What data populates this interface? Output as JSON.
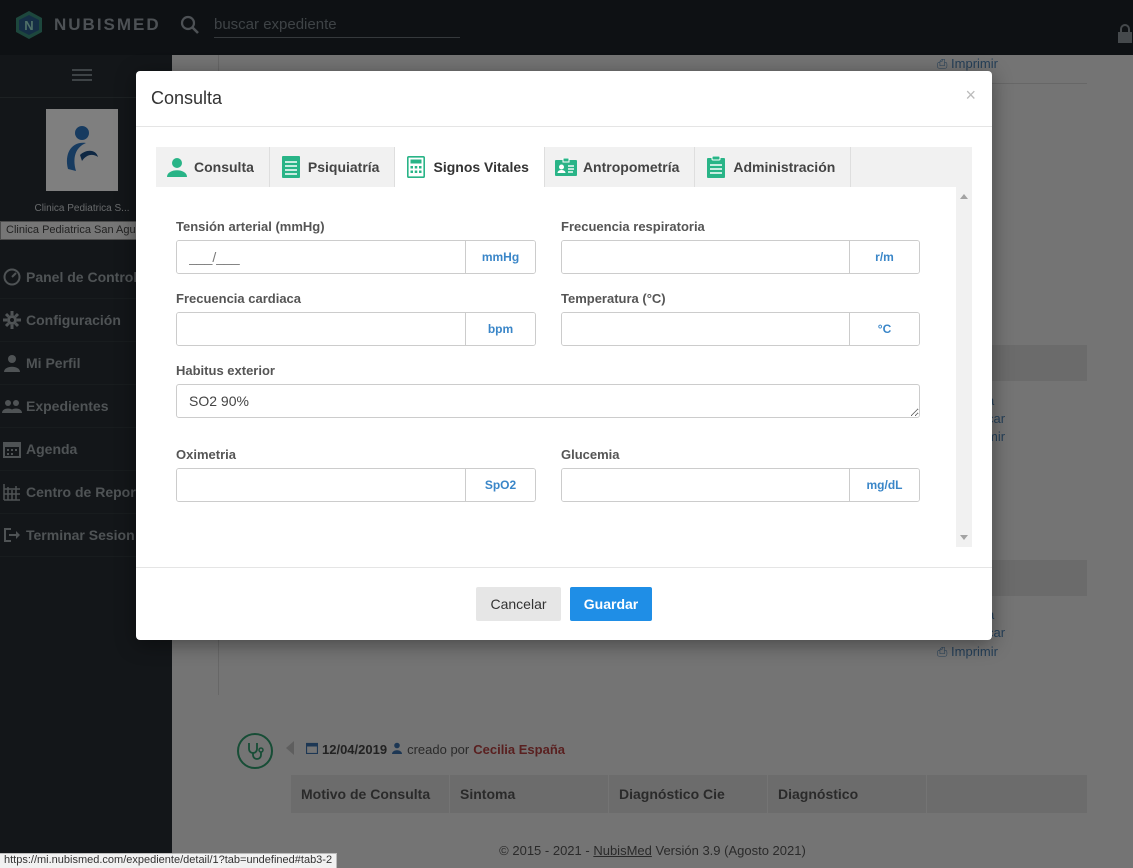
{
  "app": {
    "brand": "NUBISMED"
  },
  "search": {
    "placeholder": "buscar expediente"
  },
  "sidebar": {
    "clinic_name_short": "Clinica Pediatrica S...",
    "clinic_select_value": "Clinica Pediatrica San Agustin",
    "items": [
      {
        "label": "Panel de Control",
        "icon": "dashboard-icon"
      },
      {
        "label": "Configuración",
        "icon": "gear-icon"
      },
      {
        "label": "Mi Perfil",
        "icon": "user-icon"
      },
      {
        "label": "Expedientes",
        "icon": "users-icon"
      },
      {
        "label": "Agenda",
        "icon": "calendar-icon"
      },
      {
        "label": "Centro de Reportes",
        "icon": "report-icon"
      },
      {
        "label": "Terminar Sesion",
        "icon": "logout-icon"
      }
    ]
  },
  "background": {
    "print_link": "Imprimir",
    "partial_links": [
      "a",
      "car",
      "mir"
    ],
    "entry": {
      "date": "12/04/2019",
      "created_by_text": "creado por",
      "author": "Cecilia España"
    },
    "table_headers": [
      "Motivo de Consulta",
      "Sintoma",
      "Diagnóstico Cie",
      "Diagnóstico"
    ],
    "footer": {
      "prefix": "© 2015 - 2021 -",
      "brand": "NubisMed",
      "suffix": "Versión 3.9 (Agosto 2021)"
    },
    "status_url": "https://mi.nubismed.com/expediente/detail/1?tab=undefined#tab3-2"
  },
  "modal": {
    "title": "Consulta",
    "close": "×",
    "tabs": [
      {
        "label": "Consulta",
        "icon": "user-icon"
      },
      {
        "label": "Psiquiatría",
        "icon": "document-icon"
      },
      {
        "label": "Signos Vitales",
        "icon": "calculator-icon",
        "active": true
      },
      {
        "label": "Antropometría",
        "icon": "id-card-icon"
      },
      {
        "label": "Administración",
        "icon": "clipboard-icon"
      }
    ],
    "fields": {
      "tension": {
        "label": "Tensión arterial (mmHg)",
        "placeholder": "___/___",
        "value": "",
        "unit": "mmHg"
      },
      "frec_resp": {
        "label": "Frecuencia respiratoria",
        "value": "",
        "unit": "r/m"
      },
      "frec_card": {
        "label": "Frecuencia cardiaca",
        "value": "",
        "unit": "bpm"
      },
      "temperatura": {
        "label": "Temperatura (°C)",
        "value": "",
        "unit": "°C"
      },
      "habitus": {
        "label": "Habitus exterior",
        "value": "SO2 90%"
      },
      "oximetria": {
        "label": "Oximetria",
        "value": "",
        "unit": "SpO2"
      },
      "glucemia": {
        "label": "Glucemia",
        "value": "",
        "unit": "mg/dL"
      }
    },
    "buttons": {
      "cancel": "Cancelar",
      "save": "Guardar"
    }
  },
  "colors": {
    "accent": "#1f8ee6",
    "icon_green": "#29b487",
    "unit_blue": "#3a86c8",
    "author_red": "#b34040"
  }
}
